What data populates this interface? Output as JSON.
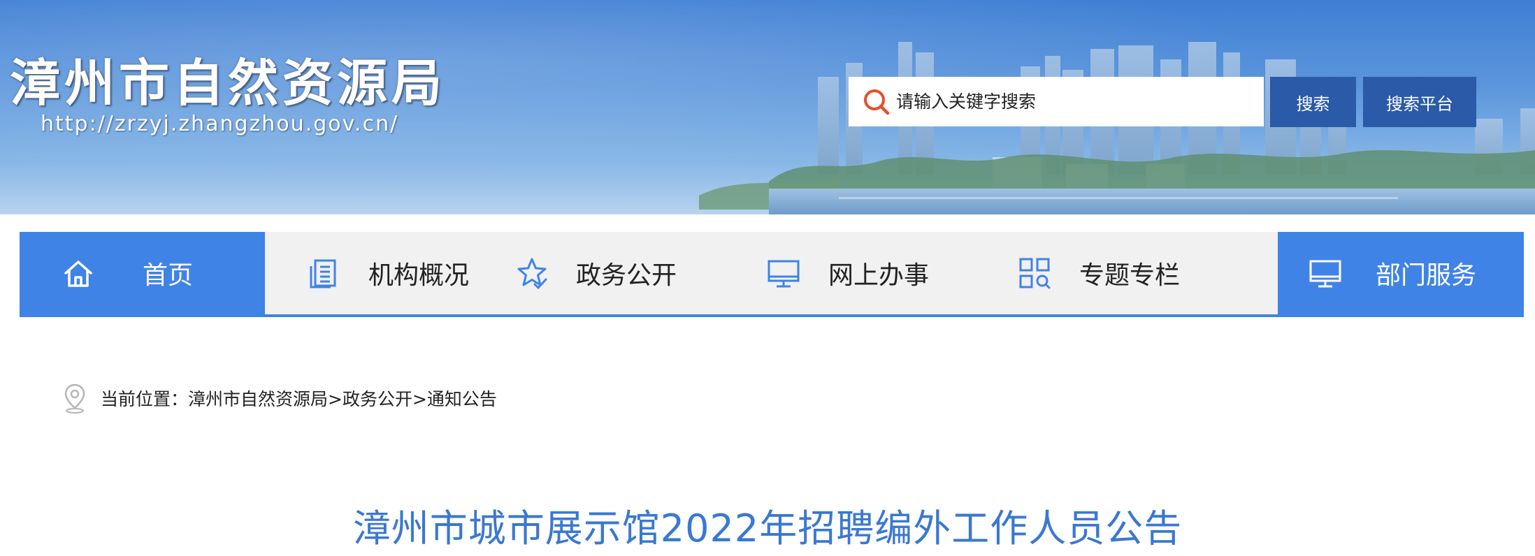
{
  "header": {
    "site_title": "漳州市自然资源局",
    "site_url": "http://zrzyj.zhangzhou.gov.cn/",
    "search": {
      "placeholder": "请输入关键字搜索",
      "value": "",
      "icon": "search-icon"
    },
    "search_button_label": "搜索",
    "platform_button_label": "搜索平台"
  },
  "nav": {
    "items": [
      {
        "label": "首页",
        "icon": "home-icon",
        "active": true
      },
      {
        "label": "机构概况",
        "icon": "document-icon",
        "active": false
      },
      {
        "label": "政务公开",
        "icon": "star-check-icon",
        "active": false
      },
      {
        "label": "网上办事",
        "icon": "monitor-icon",
        "active": false
      },
      {
        "label": "专题专栏",
        "icon": "grid-search-icon",
        "active": false
      },
      {
        "label": "部门服务",
        "icon": "monitor-icon",
        "active": true
      }
    ]
  },
  "breadcrumb": {
    "prefix": "当前位置：",
    "path": "漳州市自然资源局>政务公开>通知公告",
    "icon": "location-pin-icon"
  },
  "article": {
    "title": "漳州市城市展示馆2022年招聘编外工作人员公告"
  },
  "colors": {
    "nav_active": "#3f83e6",
    "button": "#2a5aa8",
    "title_blue": "#3a78d1",
    "nav_bg": "#f1f1f1"
  }
}
